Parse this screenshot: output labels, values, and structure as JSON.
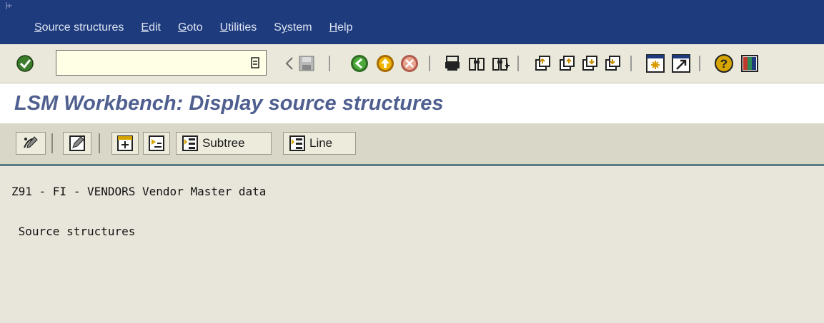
{
  "menu": {
    "items": [
      "Source structures",
      "Edit",
      "Goto",
      "Utilities",
      "System",
      "Help"
    ],
    "mnemonics": [
      "S",
      "E",
      "G",
      "U",
      "y",
      "H"
    ]
  },
  "toolbar": {
    "command_field_value": "",
    "icons": [
      "enter-icon",
      "dropdown-icon",
      "back-arrow-icon",
      "save-icon",
      "back-icon",
      "exit-icon",
      "cancel-icon",
      "print-icon",
      "find-icon",
      "find-next-icon",
      "first-page-icon",
      "previous-page-icon",
      "next-page-icon",
      "last-page-icon",
      "create-session-icon",
      "shortcut-icon",
      "help-icon",
      "customize-layout-icon"
    ]
  },
  "title": "LSM Workbench: Display source structures",
  "app_toolbar": {
    "subtree_label": "Subtree",
    "line_label": "Line"
  },
  "content": {
    "line1": "Z91 - FI - VENDORS Vendor Master data",
    "line2": " Source structures"
  },
  "colors": {
    "menubar": "#1e3b7e",
    "toolbar": "#e9e8da",
    "title": "#4f5f8f",
    "content_bg": "#e8e6da",
    "divider": "#5a7d86"
  }
}
